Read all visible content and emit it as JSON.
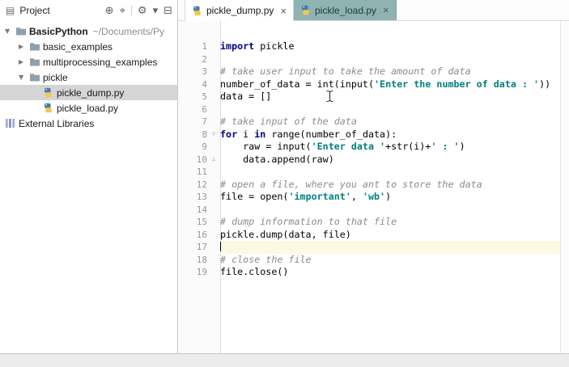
{
  "colors": {
    "keyword": "#000080",
    "string": "#008080",
    "comment": "#8c8c8c",
    "caret_line": "#fcf8e3",
    "tree_selection": "#d5d5d5",
    "inactive_tab_bg": "#8fb3b1",
    "panel_border": "#c9c9c9"
  },
  "project_panel": {
    "header": {
      "icon_glyph": "▤",
      "title": "Project",
      "actions": [
        {
          "name": "sync-project-icon",
          "glyph": "⊕"
        },
        {
          "name": "scroll-from-source-icon",
          "glyph": "⌖"
        },
        {
          "name": "divider"
        },
        {
          "name": "settings-gear-icon",
          "glyph": "⚙"
        },
        {
          "name": "chevron-down-icon",
          "glyph": "▾"
        },
        {
          "name": "hide-panel-icon",
          "glyph": "⊟"
        }
      ]
    },
    "tree": [
      {
        "label": "BasicPython",
        "hint": "~/Documents/Py",
        "icon": "folder",
        "arrow": "expanded",
        "indent": 0,
        "bold": true
      },
      {
        "label": "basic_examples",
        "icon": "folder",
        "arrow": "collapsed",
        "indent": 1
      },
      {
        "label": "multiprocessing_examples",
        "icon": "folder",
        "arrow": "collapsed",
        "indent": 1
      },
      {
        "label": "pickle",
        "icon": "folder",
        "arrow": "expanded",
        "indent": 1
      },
      {
        "label": "pickle_dump.py",
        "icon": "python",
        "arrow": "none",
        "indent": 2,
        "selected": true
      },
      {
        "label": "pickle_load.py",
        "icon": "python",
        "arrow": "none",
        "indent": 2
      },
      {
        "label": "External Libraries",
        "icon": "libraries",
        "indent": 0
      }
    ]
  },
  "tabs": [
    {
      "label": "pickle_dump.py",
      "close_glyph": "×",
      "active": true
    },
    {
      "label": "pickle_load.py",
      "close_glyph": "×",
      "active": false
    }
  ],
  "editor": {
    "lines": [
      {
        "no": "1",
        "segments": [
          [
            "kw",
            "import"
          ],
          [
            "plain",
            " pickle"
          ]
        ]
      },
      {
        "no": "2",
        "segments": []
      },
      {
        "no": "3",
        "segments": [
          [
            "com",
            "# take user input to take the amount of data"
          ]
        ]
      },
      {
        "no": "4",
        "segments": [
          [
            "plain",
            "number_of_data = int(input("
          ],
          [
            "str",
            "'Enter the number of data : '"
          ],
          [
            "plain",
            "))"
          ]
        ]
      },
      {
        "no": "5",
        "segments": [
          [
            "plain",
            "data = []"
          ]
        ]
      },
      {
        "no": "6",
        "segments": []
      },
      {
        "no": "7",
        "segments": [
          [
            "com",
            "# take input of the data"
          ]
        ]
      },
      {
        "no": "8",
        "fold": "open",
        "segments": [
          [
            "kw",
            "for"
          ],
          [
            "plain",
            " i "
          ],
          [
            "kw",
            "in"
          ],
          [
            "plain",
            " range(number_of_data):"
          ]
        ]
      },
      {
        "no": "9",
        "segments": [
          [
            "plain",
            "    raw = input("
          ],
          [
            "str",
            "'Enter data '"
          ],
          [
            "plain",
            "+str(i)+"
          ],
          [
            "str",
            "' : '"
          ],
          [
            "plain",
            ")"
          ]
        ]
      },
      {
        "no": "10",
        "fold": "end",
        "segments": [
          [
            "plain",
            "    data.append(raw)"
          ]
        ]
      },
      {
        "no": "11",
        "segments": []
      },
      {
        "no": "12",
        "segments": [
          [
            "com",
            "# open a file, where you ant to store the data"
          ]
        ]
      },
      {
        "no": "13",
        "segments": [
          [
            "plain",
            "file = open("
          ],
          [
            "str",
            "'important'"
          ],
          [
            "plain",
            ", "
          ],
          [
            "str",
            "'wb'"
          ],
          [
            "plain",
            ")"
          ]
        ]
      },
      {
        "no": "14",
        "segments": []
      },
      {
        "no": "15",
        "segments": [
          [
            "com",
            "# dump information to that file"
          ]
        ]
      },
      {
        "no": "16",
        "segments": [
          [
            "plain",
            "pickle.dump(data, file)"
          ]
        ]
      },
      {
        "no": "17",
        "caret": true,
        "segments": []
      },
      {
        "no": "18",
        "segments": [
          [
            "com",
            "# close the file"
          ]
        ]
      },
      {
        "no": "19",
        "segments": [
          [
            "plain",
            "file.close()"
          ]
        ]
      }
    ]
  }
}
